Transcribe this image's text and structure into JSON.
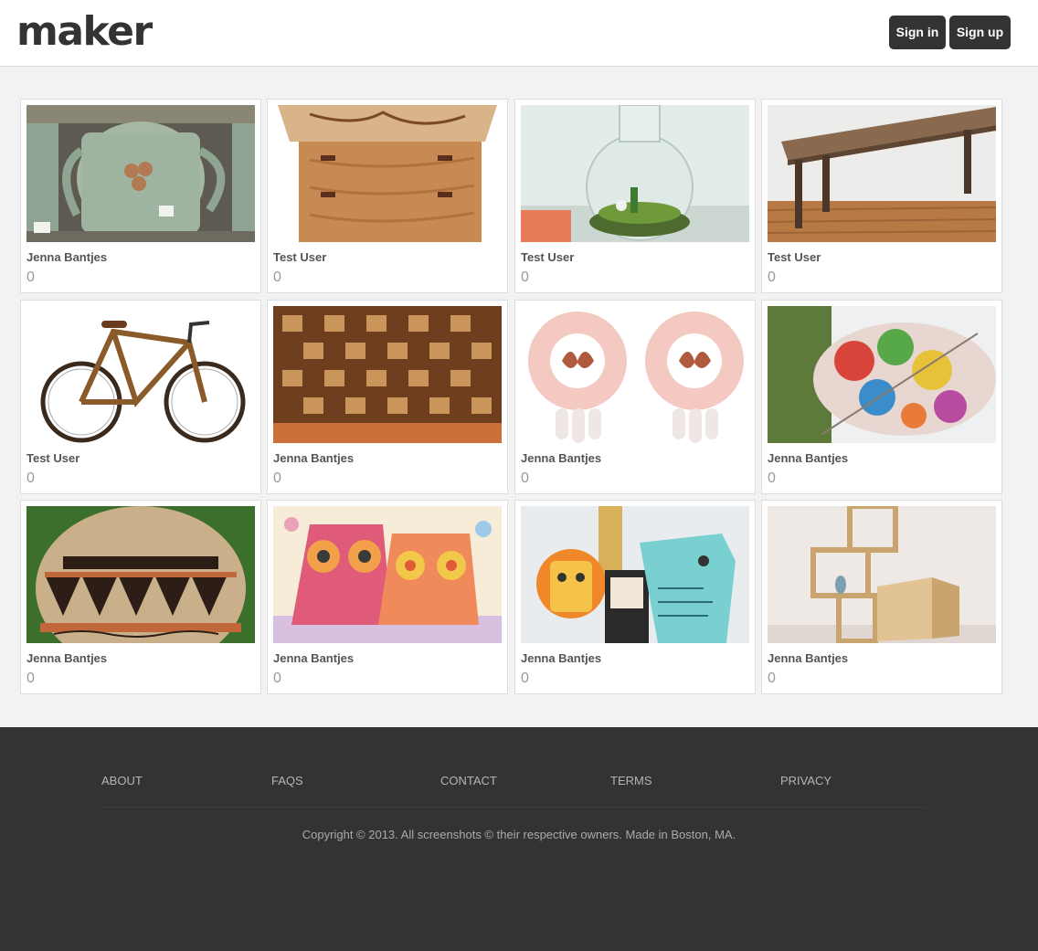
{
  "header": {
    "logo": "maker",
    "sign_in": "Sign in",
    "sign_up": "Sign up"
  },
  "items": [
    {
      "author": "Jenna Bantjes",
      "count": "0",
      "image": "ceramic-mugs"
    },
    {
      "author": "Test User",
      "count": "0",
      "image": "wooden-box"
    },
    {
      "author": "Test User",
      "count": "0",
      "image": "glass-terrarium"
    },
    {
      "author": "Test User",
      "count": "0",
      "image": "wooden-bench"
    },
    {
      "author": "Test User",
      "count": "0",
      "image": "bamboo-bicycle"
    },
    {
      "author": "Jenna Bantjes",
      "count": "0",
      "image": "cutting-board"
    },
    {
      "author": "Jenna Bantjes",
      "count": "0",
      "image": "butterfly-earrings"
    },
    {
      "author": "Jenna Bantjes",
      "count": "0",
      "image": "leaf-print"
    },
    {
      "author": "Jenna Bantjes",
      "count": "0",
      "image": "painted-vase"
    },
    {
      "author": "Jenna Bantjes",
      "count": "0",
      "image": "owl-pillows"
    },
    {
      "author": "Jenna Bantjes",
      "count": "0",
      "image": "paper-animals"
    },
    {
      "author": "Jenna Bantjes",
      "count": "0",
      "image": "wooden-shelves"
    }
  ],
  "footer": {
    "links": [
      "About",
      "FAQs",
      "Contact",
      "Terms",
      "Privacy"
    ],
    "copyright": "Copyright © 2013. All screenshots © their respective owners. Made in Boston, MA."
  }
}
